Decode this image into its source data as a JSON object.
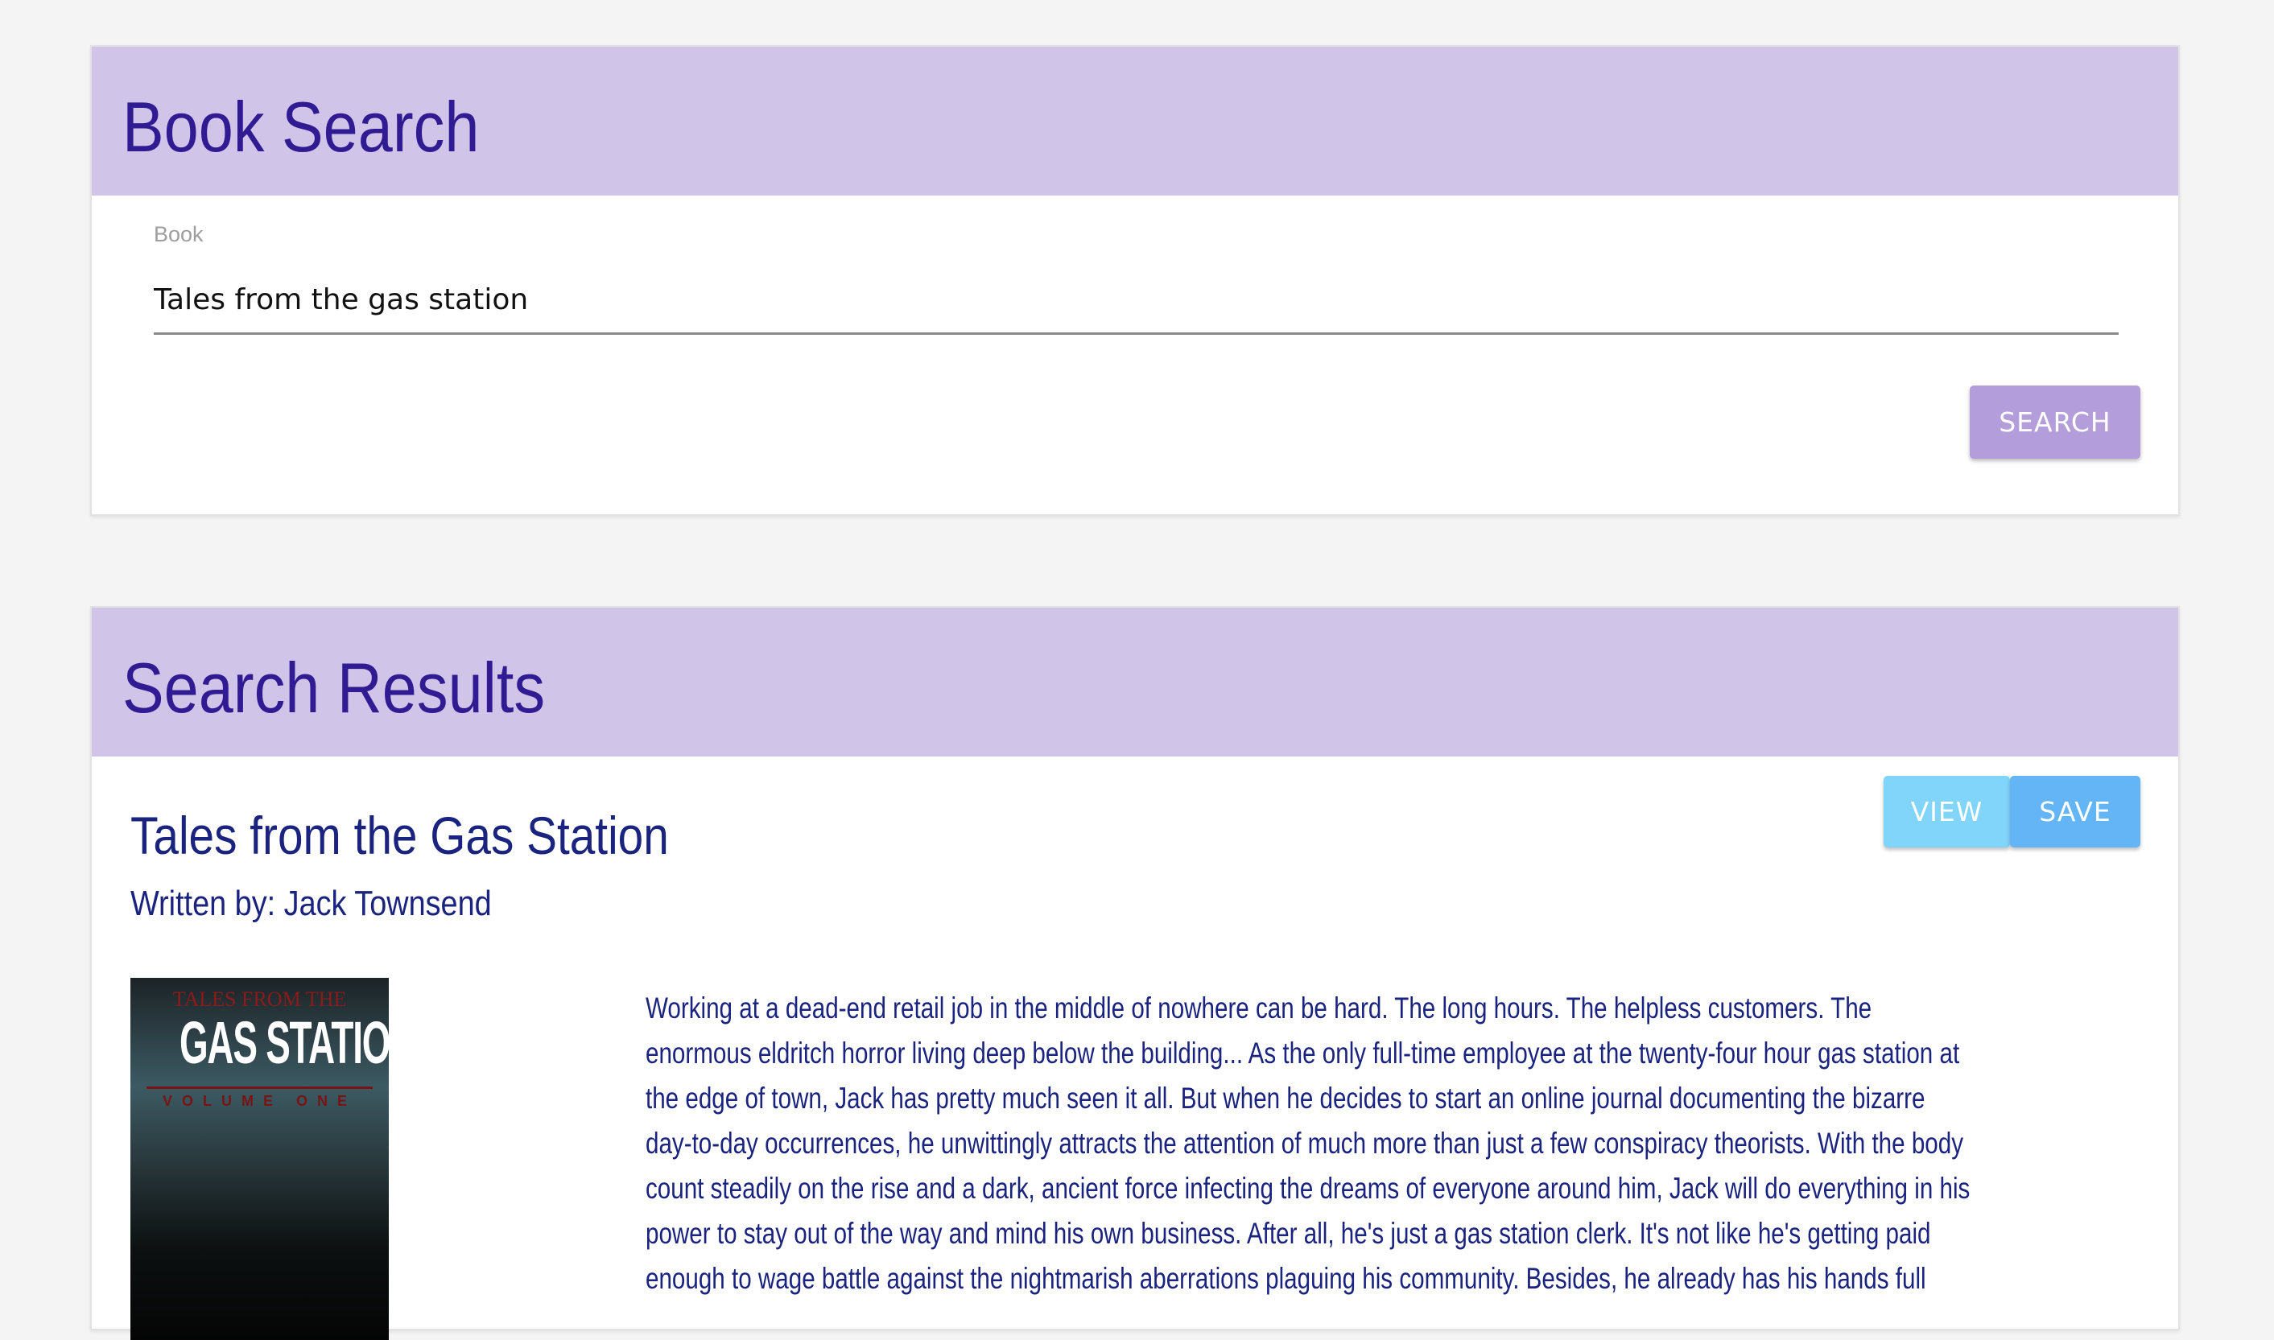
{
  "search": {
    "title": "Book Search",
    "field_label": "Book",
    "field_value": "Tales from the gas station",
    "search_button": "SEARCH"
  },
  "results": {
    "title": "Search Results",
    "items": [
      {
        "title": "Tales from the Gas Station",
        "author": "Written by: Jack Townsend",
        "view_button": "VIEW",
        "save_button": "SAVE",
        "cover_text": [
          "TALES FROM THE",
          "GAS STATION",
          "VOLUME ONE"
        ],
        "description_lines": [
          "Working at a dead-end retail job in the middle of nowhere can be hard. The long hours. The helpless customers. The",
          "enormous eldritch horror living deep below the building... As the only full-time employee at the twenty-four hour gas station at",
          "the edge of town, Jack has pretty much seen it all. But when he decides to start an online journal documenting the bizarre",
          "day-to-day occurrences, he unwittingly attracts the attention of much more than just a few conspiracy theorists. With the body",
          "count steadily on the rise and a dark, ancient force infecting the dreams of everyone around him, Jack will do everything in his",
          "power to stay out of the way and mind his own business. After all, he's just a gas station clerk. It's not like he's getting paid",
          "enough to wage battle against the nightmarish aberrations plaguing his community. Besides, he already has his hands full"
        ]
      }
    ]
  }
}
